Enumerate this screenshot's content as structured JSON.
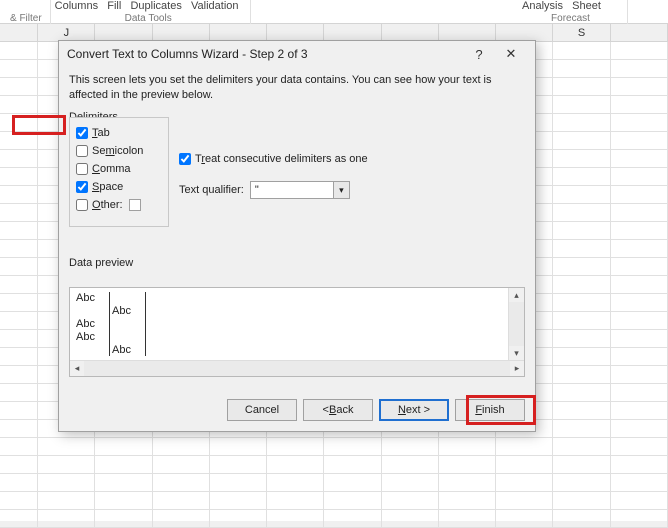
{
  "ribbon": {
    "filter_group": "& Filter",
    "columns": "Columns",
    "fill": "Fill",
    "duplicates": "Duplicates",
    "validation": "Validation",
    "data_tools": "Data Tools",
    "analysis": "Analysis",
    "sheet": "Sheet",
    "forecast": "Forecast"
  },
  "col_headers": {
    "J": "J",
    "S": "S"
  },
  "dialog": {
    "title": "Convert Text to Columns Wizard - Step 2 of 3",
    "help": "?",
    "close": "✕",
    "desc": "This screen lets you set the delimiters your data contains.  You can see how your text is affected in the preview below.",
    "delim_label": "Delimiters",
    "tab": "ab",
    "tab_u": "T",
    "semicolon": "Se",
    "semicolon_u": "m",
    "semicolon2": "icolon",
    "comma": "omma",
    "comma_u": "C",
    "space": "pace",
    "space_u": "S",
    "other": "ther:",
    "other_u": "O",
    "treat": "T",
    "treat_u": "r",
    "treat2": "eat consecutive delimiters as one",
    "tq_label": "Text ",
    "tq_u": "q",
    "tq_label2": "ualifier:",
    "tq_value": "\"",
    "preview_label": "Data ",
    "preview_u": "p",
    "preview_label2": "review",
    "preview": {
      "r0c0": "Abc",
      "r0c1": "",
      "r1c0": "",
      "r1c1": "Abc",
      "r2c0": "Abc",
      "r2c1": "",
      "r3c0": "Abc",
      "r3c1": "",
      "r4c0": "",
      "r4c1": "Abc"
    },
    "cancel": "Cancel",
    "back": "< ",
    "back_u": "B",
    "back2": "ack",
    "next_u": "N",
    "next": "ext >",
    "finish_u": "F",
    "finish": "inish"
  }
}
